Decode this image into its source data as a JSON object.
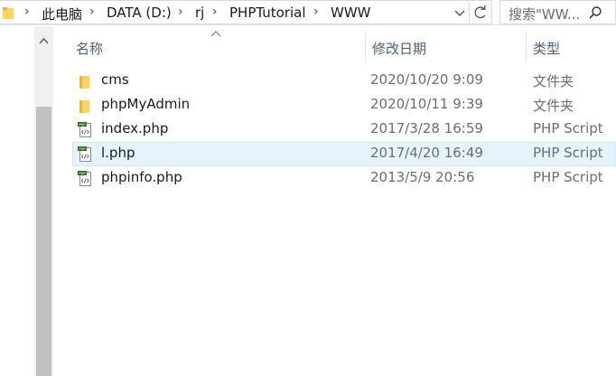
{
  "address_bar": {
    "breadcrumbs": [
      "此电脑",
      "DATA (D:)",
      "rj",
      "PHPTutorial",
      "WWW"
    ]
  },
  "search": {
    "placeholder": "搜索\"WW..."
  },
  "file_list": {
    "columns": {
      "name": "名称",
      "date": "修改日期",
      "type": "类型"
    },
    "rows": [
      {
        "name": "cms",
        "date": "2020/10/20 9:09",
        "type": "文件夹",
        "kind": "folder",
        "selected": false
      },
      {
        "name": "phpMyAdmin",
        "date": "2020/10/11 9:39",
        "type": "文件夹",
        "kind": "folder",
        "selected": false
      },
      {
        "name": "index.php",
        "date": "2017/3/28 16:59",
        "type": "PHP Script",
        "kind": "php",
        "selected": false
      },
      {
        "name": "l.php",
        "date": "2017/4/20 16:49",
        "type": "PHP Script",
        "kind": "php",
        "selected": true
      },
      {
        "name": "phpinfo.php",
        "date": "2013/5/9 20:56",
        "type": "PHP Script",
        "kind": "php",
        "selected": false
      }
    ]
  },
  "colors": {
    "folder": "#ffd35c",
    "selection": "#e5f3ff",
    "header_text": "#4c607a"
  }
}
